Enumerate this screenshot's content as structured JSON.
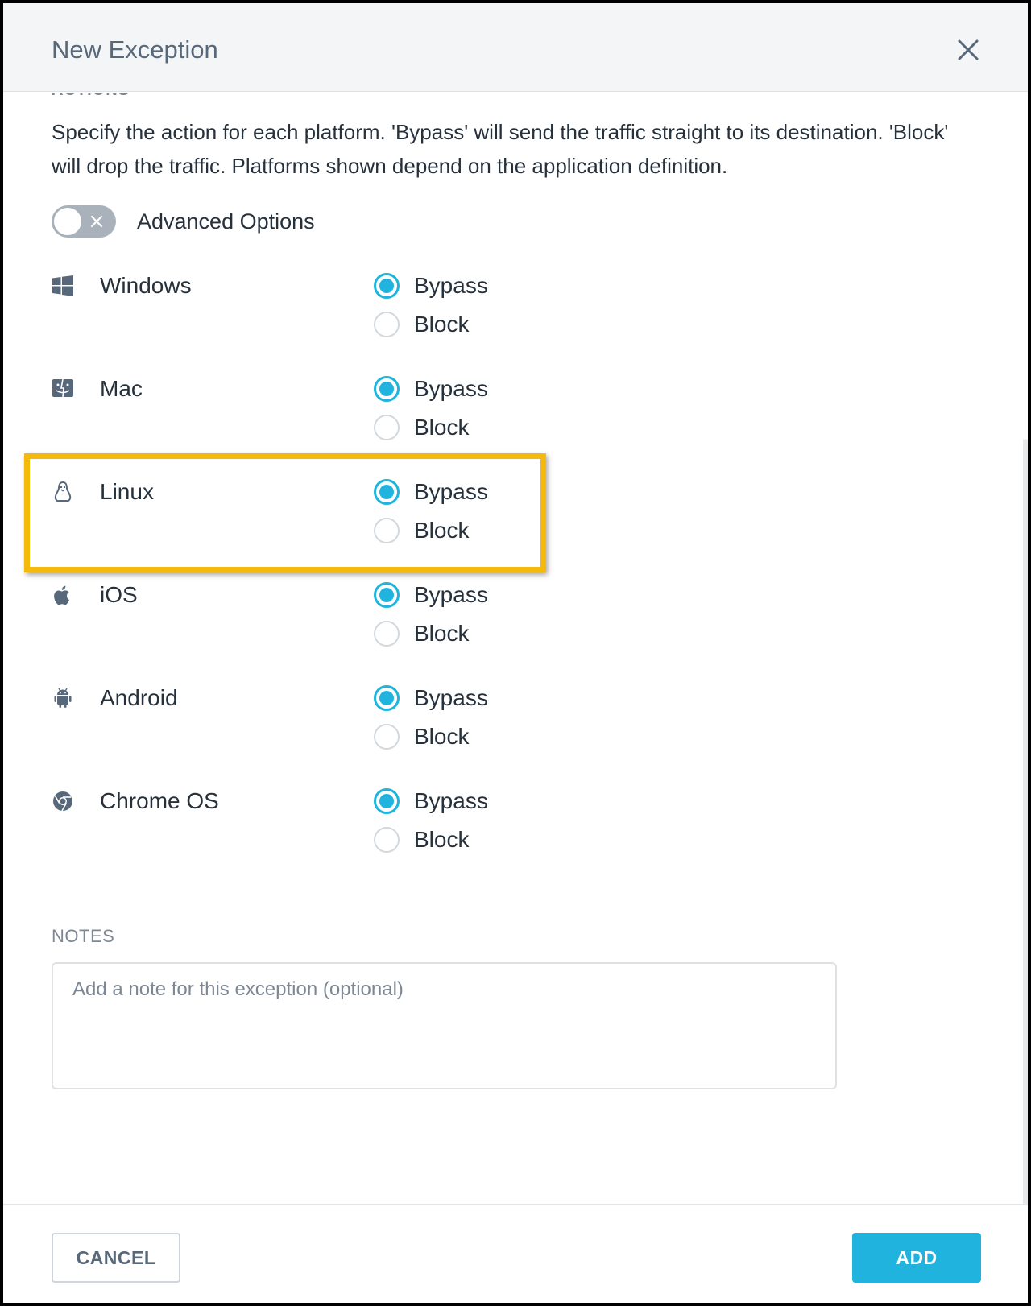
{
  "dialog": {
    "title": "New Exception",
    "close_icon": "close-icon"
  },
  "actions_section": {
    "heading_clipped": "ACTIONS",
    "description": "Specify the action for each platform. 'Bypass' will send the traffic straight to its destination. 'Block' will drop the traffic. Platforms shown depend on the application definition."
  },
  "advanced_options": {
    "label": "Advanced Options",
    "enabled": false
  },
  "platforms": [
    {
      "name": "Windows",
      "icon": "windows-icon",
      "options": [
        "Bypass",
        "Block"
      ],
      "selected": "Bypass"
    },
    {
      "name": "Mac",
      "icon": "mac-finder-icon",
      "options": [
        "Bypass",
        "Block"
      ],
      "selected": "Bypass"
    },
    {
      "name": "Linux",
      "icon": "linux-tux-icon",
      "options": [
        "Bypass",
        "Block"
      ],
      "selected": "Bypass"
    },
    {
      "name": "iOS",
      "icon": "apple-icon",
      "options": [
        "Bypass",
        "Block"
      ],
      "selected": "Bypass"
    },
    {
      "name": "Android",
      "icon": "android-icon",
      "options": [
        "Bypass",
        "Block"
      ],
      "selected": "Bypass"
    },
    {
      "name": "Chrome OS",
      "icon": "chrome-icon",
      "options": [
        "Bypass",
        "Block"
      ],
      "selected": "Bypass"
    }
  ],
  "highlighted_platform": "Linux",
  "notes": {
    "label": "NOTES",
    "placeholder": "Add a note for this exception (optional)",
    "value": ""
  },
  "footer": {
    "cancel_label": "CANCEL",
    "add_label": "ADD"
  },
  "colors": {
    "accent": "#1fb3dd",
    "highlight": "#f5b80c",
    "header_bg": "#f4f5f6"
  }
}
